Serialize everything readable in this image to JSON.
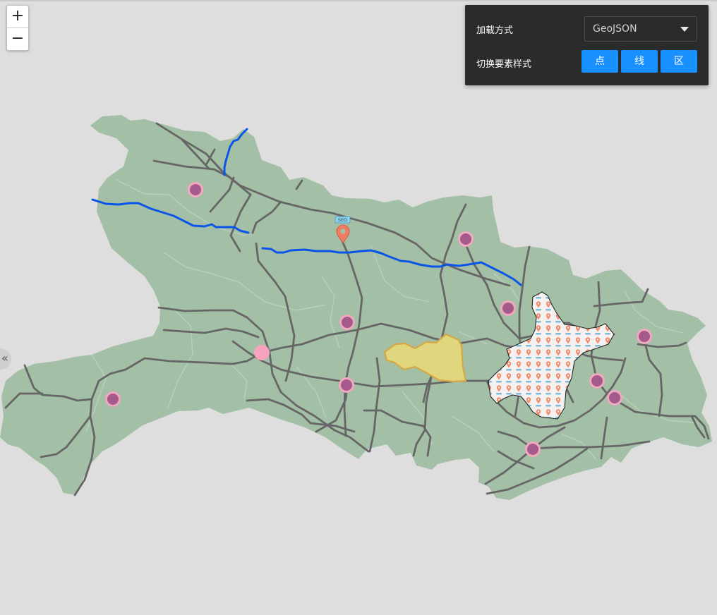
{
  "zoom": {
    "in_label": "+",
    "out_label": "−"
  },
  "panel": {
    "load_label": "加载方式",
    "load_value": "GeoJSON",
    "style_label": "切换要素样式",
    "buttons": [
      "点",
      "线",
      "区"
    ]
  },
  "side_toggle": {
    "label": "«"
  },
  "marker": {
    "tag": "SEO"
  },
  "colors": {
    "land": "#a3bfa6",
    "road": "#666666",
    "river": "#0a55e8",
    "poi_fill": "#a45a8a",
    "poi_ring": "#f2a9bf",
    "highlight_fill": "#e0d67e",
    "highlight_stroke": "#d6a844",
    "button": "#1890ff"
  }
}
